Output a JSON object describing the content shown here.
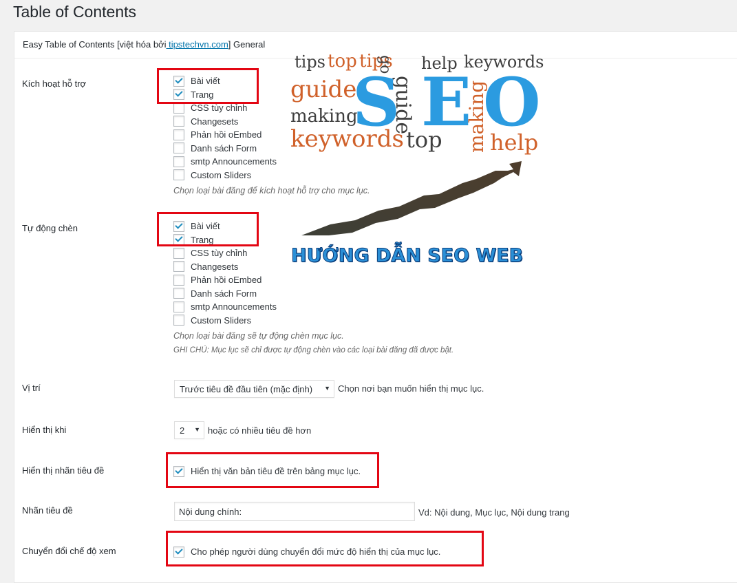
{
  "page_title": "Table of Contents",
  "panel": {
    "heading_prefix": "Easy Table of Contents [việt hóa bởi",
    "heading_link": " tipstechvn.com",
    "heading_suffix": "] General"
  },
  "enable_support": {
    "label": "Kích hoạt hỗ trợ",
    "options": [
      {
        "label": "Bài viết",
        "checked": true
      },
      {
        "label": "Trang",
        "checked": true
      },
      {
        "label": "CSS tùy chỉnh",
        "checked": false
      },
      {
        "label": "Changesets",
        "checked": false
      },
      {
        "label": "Phản hồi oEmbed",
        "checked": false
      },
      {
        "label": "Danh sách Form",
        "checked": false
      },
      {
        "label": "smtp Announcements",
        "checked": false
      },
      {
        "label": "Custom Sliders",
        "checked": false
      }
    ],
    "description": "Chọn loại bài đăng để kích hoạt hỗ trợ cho mục lục."
  },
  "auto_insert": {
    "label": "Tự động chèn",
    "options": [
      {
        "label": "Bài viết",
        "checked": true
      },
      {
        "label": "Trang",
        "checked": true
      },
      {
        "label": "CSS tùy chỉnh",
        "checked": false
      },
      {
        "label": "Changesets",
        "checked": false
      },
      {
        "label": "Phản hồi oEmbed",
        "checked": false
      },
      {
        "label": "Danh sách Form",
        "checked": false
      },
      {
        "label": "smtp Announcements",
        "checked": false
      },
      {
        "label": "Custom Sliders",
        "checked": false
      }
    ],
    "description": "Chọn loại bài đăng sẽ tự động chèn mục lục.",
    "note": "GHI CHÚ: Mục lục sẽ chỉ được tự động chèn vào các loại bài đăng đã được bật."
  },
  "position": {
    "label": "Vị trí",
    "selected": "Trước tiêu đề đầu tiên (mặc định)",
    "help": "Chọn nơi bạn muốn hiển thị mục lục."
  },
  "show_when": {
    "label": "Hiển thị khi",
    "selected": "2",
    "help": "hoặc có nhiều tiêu đề hơn"
  },
  "show_header_label": {
    "label": "Hiển thị nhãn tiêu đề",
    "checkbox_label": "Hiển thị văn bản tiêu đề trên bảng mục lục.",
    "checked": true
  },
  "header_label": {
    "label": "Nhãn tiêu đề",
    "value": "Nội dung chính:",
    "help": "Vd: Nội dung, Mục lục, Nội dung trang"
  },
  "toggle_view": {
    "label": "Chuyển đổi chế độ xem",
    "checkbox_label": "Cho phép người dùng chuyển đổi mức độ hiển thị của mục lục.",
    "checked": true
  },
  "seo_image": {
    "words": [
      "tips",
      "top",
      "tips",
      "go",
      "help",
      "keywords",
      "guide",
      "guide",
      "making",
      "keywords",
      "top",
      "making",
      "help"
    ],
    "big_letters": [
      "S",
      "E",
      "O"
    ],
    "caption": "HƯỚNG DẪN SEO WEB"
  },
  "colors": {
    "accent": "#0073aa",
    "highlight_box": "#e30613",
    "checkmark": "#1e8cbe"
  }
}
